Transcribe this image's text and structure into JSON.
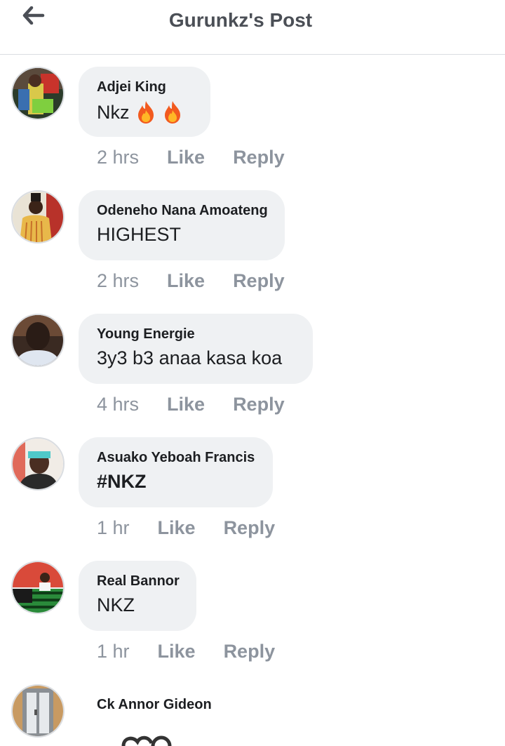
{
  "header": {
    "title": "Gurunkz's Post",
    "back_icon": "arrow-left-icon"
  },
  "comments": [
    {
      "author": "Adjei King",
      "text": "Nkz",
      "emoji": [
        "fire-icon",
        "fire-icon"
      ],
      "time": "2 hrs",
      "like_label": "Like",
      "reply_label": "Reply"
    },
    {
      "author": "Odeneho Nana Amoateng",
      "text": "HIGHEST",
      "time": "2 hrs",
      "like_label": "Like",
      "reply_label": "Reply"
    },
    {
      "author": "Young Energie",
      "text": "3y3 b3 anaa kasa koa",
      "time": "4 hrs",
      "like_label": "Like",
      "reply_label": "Reply"
    },
    {
      "author": "Asuako Yeboah Francis",
      "text": "#NKZ",
      "time": "1 hr",
      "like_label": "Like",
      "reply_label": "Reply"
    },
    {
      "author": "Real Bannor",
      "text": "NKZ",
      "time": "1 hr",
      "like_label": "Like",
      "reply_label": "Reply"
    },
    {
      "author": "Ck Annor Gideon"
    }
  ],
  "colors": {
    "bubble": "#eff1f3",
    "meta_text": "#8d949e",
    "title_text": "#4b4f56"
  }
}
